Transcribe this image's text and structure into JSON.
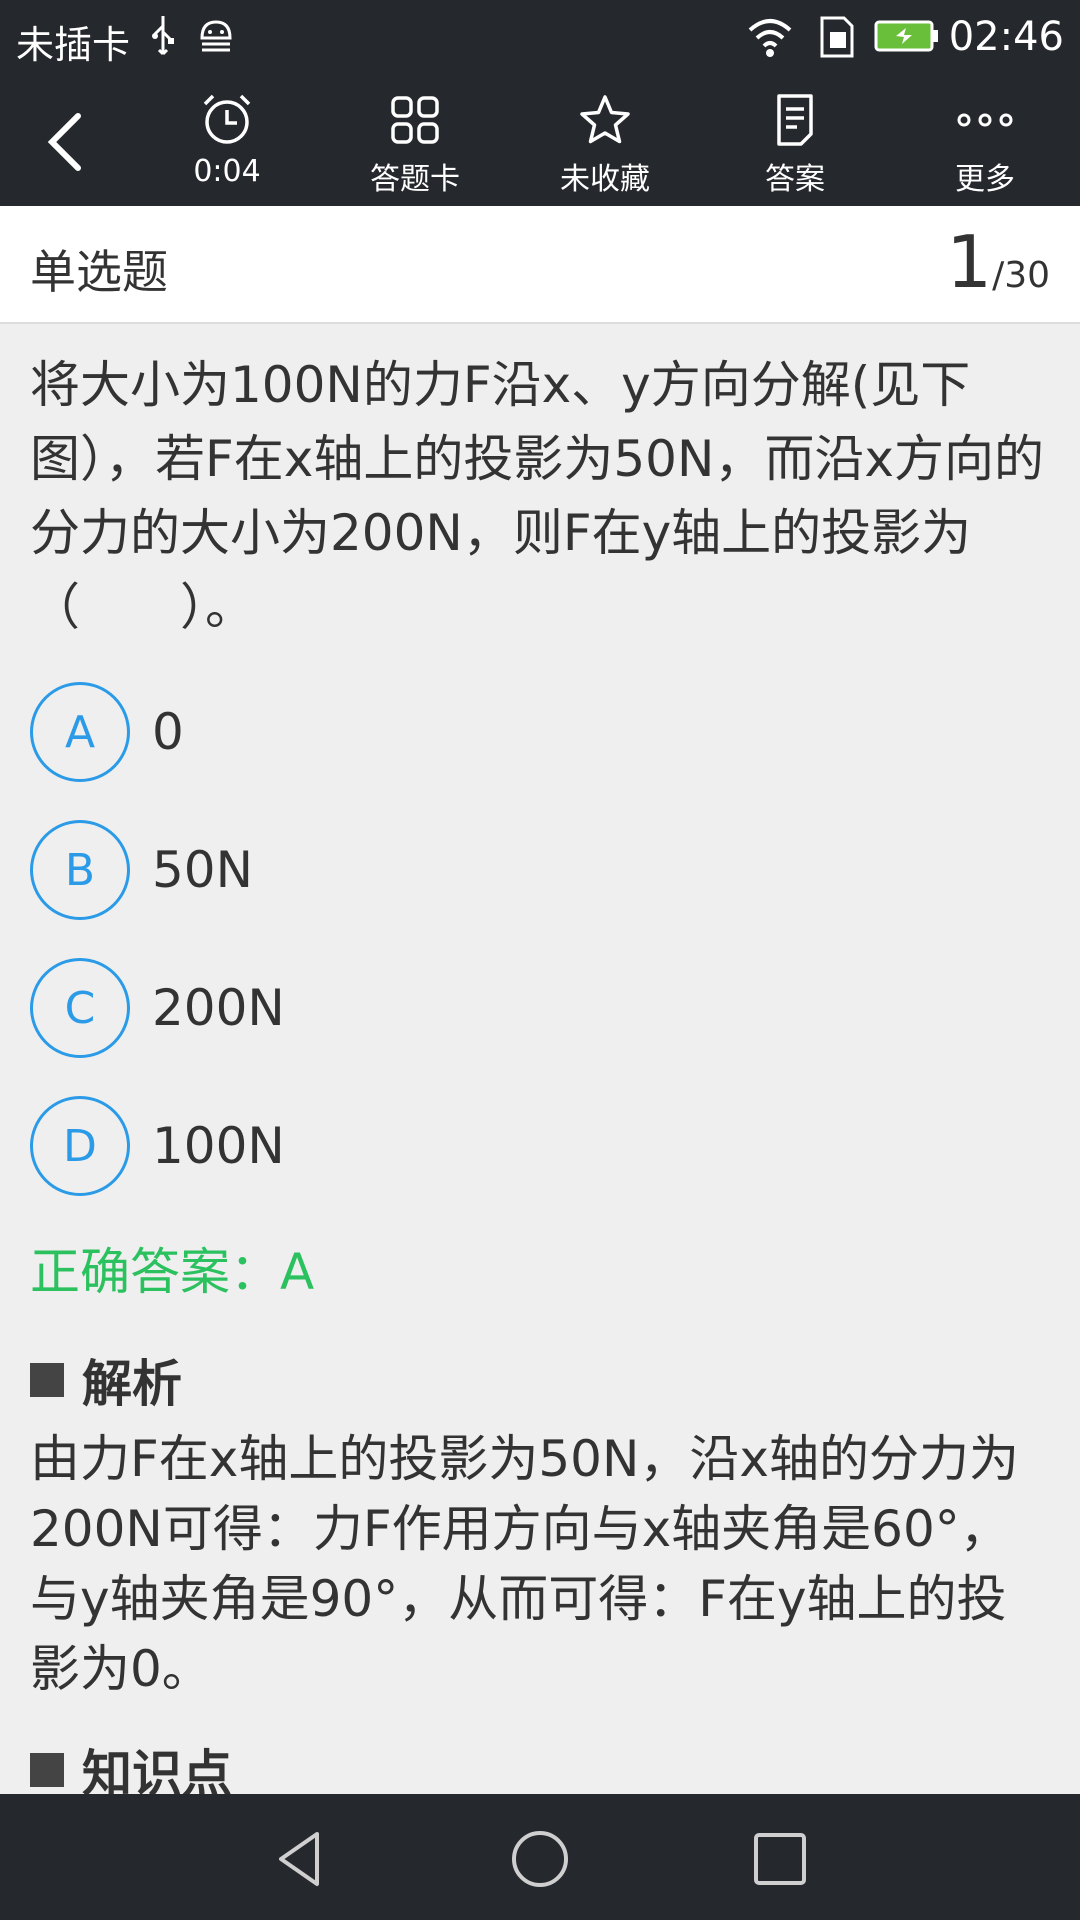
{
  "status_bar": {
    "carrier": "未插卡",
    "time": "02:46",
    "icons": [
      "usb-icon",
      "android-debug-icon",
      "wifi-icon",
      "sim-icon",
      "battery-charging-icon"
    ]
  },
  "toolbar": {
    "back_icon": "back-arrow-icon",
    "timer_label": "0:04",
    "answer_card_label": "答题卡",
    "favorite_label": "未收藏",
    "answer_label": "答案",
    "more_label": "更多"
  },
  "header": {
    "type": "单选题",
    "current": "1",
    "total": "/30"
  },
  "question": {
    "text": "将大小为100N的力F沿x、y方向分解(见下图），若F在x轴上的投影为50N，而沿x方向的分力的大小为200N，则F在y轴上的投影为（　　）。",
    "options": [
      {
        "letter": "A",
        "text": "0"
      },
      {
        "letter": "B",
        "text": "50N"
      },
      {
        "letter": "C",
        "text": "200N"
      },
      {
        "letter": "D",
        "text": "100N"
      }
    ],
    "correct_answer": "正确答案：A",
    "analysis_title": "解析",
    "analysis_text": "由力F在x轴上的投影为50N，沿x轴的分力为200N可得：力F作用方向与x轴夹角是60°，与y轴夹角是90°，从而可得：F在y轴上的投影为0。",
    "knowledge_title": "知识点"
  },
  "colors": {
    "bar_bg": "#25282d",
    "option_blue": "#2b9be8",
    "answer_green": "#2cc15f",
    "page_bg": "#efefef"
  }
}
